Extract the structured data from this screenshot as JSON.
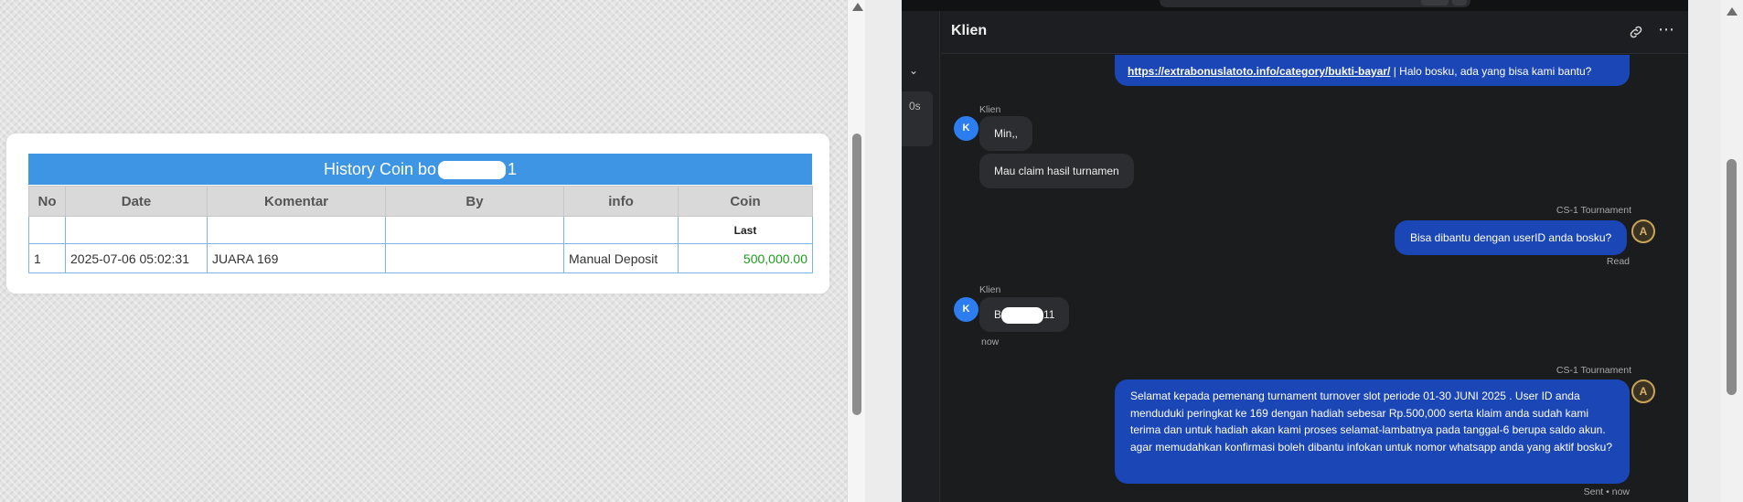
{
  "history": {
    "title_prefix": "History Coin bo",
    "title_suffix": "1",
    "headers": [
      "No",
      "Date",
      "Komentar",
      "By",
      "info",
      "Coin"
    ],
    "sub_header": "Last",
    "rows": [
      {
        "no": "1",
        "date": "2025-07-06 05:02:31",
        "komentar": "JUARA 169",
        "by": "",
        "info": "Manual Deposit",
        "coin": "500,000.00"
      }
    ]
  },
  "chat": {
    "title": "Klien",
    "side_chip": "0s",
    "messages": {
      "top": {
        "link": "https://extrabonuslatoto.info/category/bukti-bayar/",
        "text": "| Halo bosku, ada yang bisa kami bantu?"
      },
      "client1_sender": "Klien",
      "client1_a": "Min,,",
      "client1_b": "Mau claim hasil turnamen",
      "agent1_sender": "CS-1 Tournament",
      "agent1_text": "Bisa dibantu dengan userID anda bosku?",
      "agent1_status": "Read",
      "client2_sender": "Klien",
      "client2_prefix": "B",
      "client2_suffix": "11",
      "client2_time": "now",
      "agent2_sender": "CS-1 Tournament",
      "agent2_text": "Selamat kepada pemenang turnament turnover slot periode 01-30 JUNI 2025 . User ID anda menduduki peringkat ke 169 dengan hadiah sebesar Rp.500,000 serta klaim anda sudah kami terima dan untuk hadiah akan kami proses selamat-lambatnya pada tanggal-6 berupa saldo akun. agar memudahkan konfirmasi boleh dibantu infokan untuk nomor whatsapp anda yang aktif bosku?",
      "agent2_status": "Sent • now"
    },
    "avatar_client": "K",
    "avatar_agent": "A"
  },
  "colors": {
    "table_header": "#3d95e4",
    "coin_green": "#1e9b1e",
    "outgoing_bubble": "#1b46b5",
    "incoming_bubble": "#2c2d31",
    "chat_bg": "#1b1c1e"
  },
  "icons": [
    "link-icon",
    "more-icon",
    "chevron-down-icon"
  ]
}
